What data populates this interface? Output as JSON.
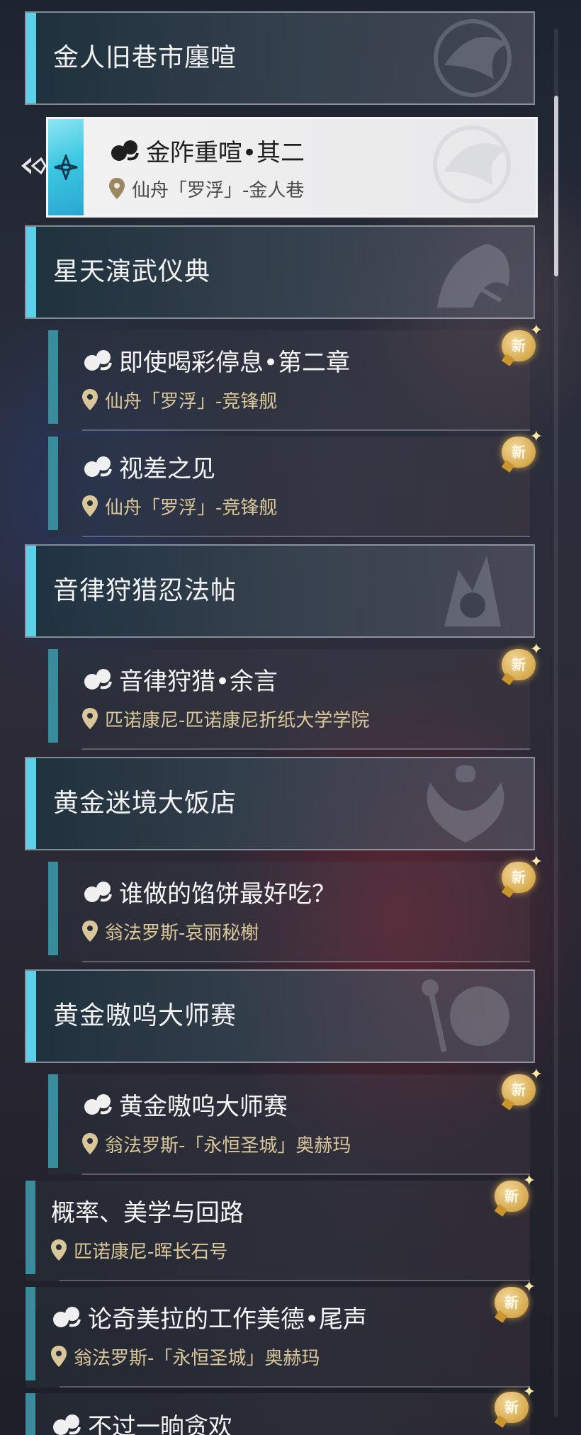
{
  "categories": [
    {
      "title": "金人旧巷市廛喧",
      "emblem": "bird-emblem"
    },
    {
      "title": "星天演武仪典",
      "emblem": "dragon-emblem"
    },
    {
      "title": "音律狩猎忍法帖",
      "emblem": "ninja-emblem"
    },
    {
      "title": "黄金迷境大饭店",
      "emblem": "chef-emblem"
    },
    {
      "title": "黄金嗷呜大师赛",
      "emblem": "mascot-emblem"
    }
  ],
  "selected_quest": {
    "title": "金阼重喧•其二",
    "location": "仙舟「罗浮」-金人巷",
    "icon": "quest-icon"
  },
  "quests": [
    {
      "title": "即使喝彩停息•第二章",
      "location": "仙舟「罗浮」-竞锋舰",
      "badge": "新"
    },
    {
      "title": "视差之见",
      "location": "仙舟「罗浮」-竞锋舰",
      "badge": "新"
    },
    {
      "title": "音律狩猎•余言",
      "location": "匹诺康尼-匹诺康尼折纸大学学院",
      "badge": "新"
    },
    {
      "title": "谁做的馅饼最好吃？",
      "location": "翁法罗斯-哀丽秘榭",
      "badge": "新"
    },
    {
      "title": "黄金嗷呜大师赛",
      "location": "翁法罗斯-「永恒圣城」奥赫玛",
      "badge": "新"
    },
    {
      "title": "概率、美学与回路",
      "location": "匹诺康尼-晖长石号",
      "badge": "新"
    },
    {
      "title": "论奇美拉的工作美德•尾声",
      "location": "翁法罗斯-「永恒圣城」奥赫玛",
      "badge": "新"
    },
    {
      "title": "不过一晌贪欢",
      "location": "",
      "badge": "新"
    }
  ],
  "colors": {
    "accent": "#5ad1e8",
    "badge": "#d9a541",
    "location_text": "#d9c79a"
  }
}
